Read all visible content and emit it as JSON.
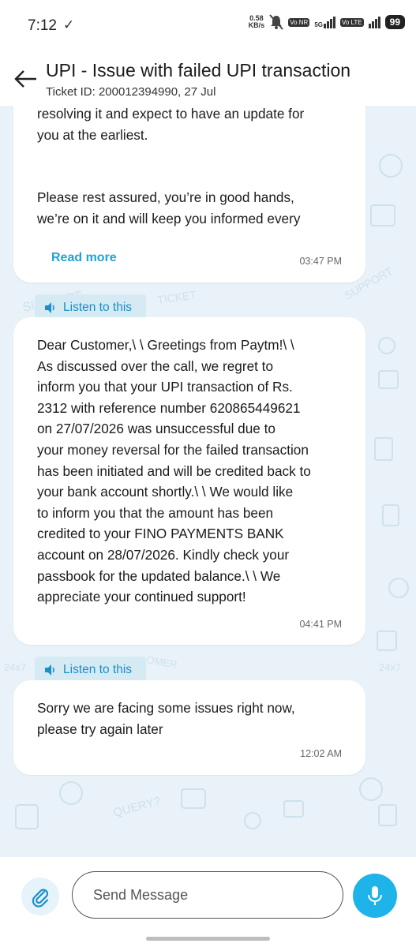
{
  "status_bar": {
    "time": "7:12",
    "check_icon": "check-mark-icon",
    "speed_value": "0.58",
    "speed_unit": "KB/s",
    "badge_vonr": "Vo NR",
    "badge_5g": "5G",
    "badge_volte": "Vo LTE",
    "battery": "99"
  },
  "header": {
    "title": "UPI - Issue with failed UPI transaction",
    "subtitle": "Ticket ID: 200012394990, 27 Jul"
  },
  "messages": [
    {
      "lines": [
        "resolving it and expect to have an update for",
        "you at the earliest.",
        "",
        "",
        "Please rest assured, you’re in good hands,",
        "we’re on it and will keep you informed every"
      ],
      "read_more": "Read more",
      "time": "03:47 PM"
    },
    {
      "listen_label": "Listen to this",
      "lines": [
        "Dear Customer,\\ \\ Greetings from Paytm!\\ \\",
        "As discussed over the call, we regret to",
        "inform you that your UPI transaction of Rs.",
        "2312 with reference number 620865449621",
        "on 27/07/2026 was unsuccessful due to",
        "your money reversal for the failed transaction",
        "has been initiated and will be credited back to",
        "your bank account shortly.\\ \\ We would like",
        "to inform you that the amount has been",
        "credited to your FINO PAYMENTS BANK",
        "account on 28/07/2026. Kindly check your",
        "passbook for the updated balance.\\ \\ We",
        "appreciate your continued support!"
      ],
      "time": "04:41 PM"
    },
    {
      "listen_label": "Listen to this",
      "lines": [
        "Sorry we are facing some issues right now,",
        "please try again later"
      ],
      "time": "12:02 AM"
    }
  ],
  "composer": {
    "placeholder": "Send Message"
  },
  "colors": {
    "accent": "#1eb3e9",
    "link": "#1fa3d6",
    "background": "#e8f2f8"
  }
}
